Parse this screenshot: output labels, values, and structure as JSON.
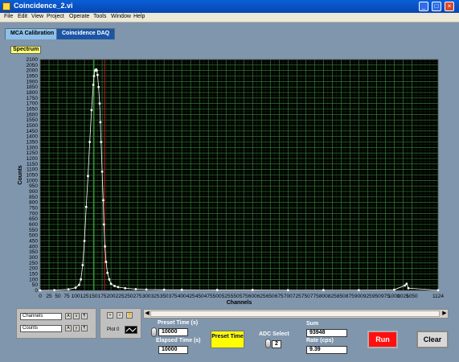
{
  "window": {
    "title": "Coincidence_2.vi"
  },
  "menu": [
    "File",
    "Edit",
    "View",
    "Project",
    "Operate",
    "Tools",
    "Window",
    "Help"
  ],
  "tabs": [
    {
      "label": "MCA Calibration",
      "active": true
    },
    {
      "label": "Coincidence DAQ",
      "active": false
    }
  ],
  "spectrum": {
    "label": "Spectrum"
  },
  "legend": {
    "x_axis_name": "Channels",
    "y_axis_name": "Counts",
    "plot_name": "Plot 0"
  },
  "controls": {
    "preset_time_label": "Preset Time (s)",
    "preset_time_value": "10000",
    "elapsed_time_label": "Elapsed Time (s)",
    "elapsed_time_value": "10000",
    "preset_button": "Preset Time",
    "adc_select_label": "ADC Select",
    "adc_select_value": "2",
    "sum_label": "Sum",
    "sum_value": "93948",
    "rate_label": "Rate (cps)",
    "rate_value": "9.39",
    "run_button": "Run",
    "clear_button": "Clear"
  },
  "chart_data": {
    "type": "scatter",
    "xlabel": "Channels",
    "ylabel": "Counts",
    "xlim": [
      0,
      1124
    ],
    "ylim": [
      0,
      2100
    ],
    "x_ticks": [
      0,
      25,
      50,
      75,
      100,
      125,
      150,
      175,
      200,
      225,
      250,
      275,
      300,
      325,
      350,
      375,
      400,
      425,
      450,
      475,
      500,
      525,
      550,
      575,
      600,
      625,
      650,
      675,
      700,
      725,
      750,
      775,
      800,
      825,
      850,
      875,
      900,
      925,
      950,
      975,
      1000,
      1025,
      1050,
      1124
    ],
    "x_tick_labels": [
      "0",
      "25",
      "50",
      "75",
      "100",
      "125",
      "150",
      "175",
      "200",
      "225",
      "250",
      "275",
      "300",
      "325",
      "350",
      "375",
      "400",
      "425",
      "450",
      "475",
      "500",
      "525",
      "550",
      "575",
      "600",
      "625",
      "650",
      "675",
      "700",
      "725",
      "750",
      "775",
      "800",
      "825",
      "850",
      "875",
      "900",
      "925",
      "950",
      "975",
      "1000",
      "1025",
      "1050",
      "1124"
    ],
    "y_ticks": [
      0,
      50,
      100,
      150,
      200,
      250,
      300,
      350,
      400,
      450,
      500,
      550,
      600,
      650,
      700,
      750,
      800,
      850,
      900,
      950,
      1000,
      1050,
      1100,
      1150,
      1200,
      1250,
      1300,
      1350,
      1400,
      1450,
      1500,
      1550,
      1600,
      1650,
      1700,
      1750,
      1800,
      1850,
      1900,
      1950,
      2000,
      2050,
      2100
    ],
    "grid": true,
    "background": "#000000",
    "grid_color": "#1f5a1f",
    "series": [
      {
        "color": "#ffffff",
        "x": [
          0,
          40,
          80,
          100,
          110,
          115,
          120,
          125,
          130,
          135,
          140,
          145,
          150,
          152,
          155,
          158,
          160,
          162,
          165,
          168,
          170,
          172,
          175,
          178,
          180,
          183,
          186,
          190,
          195,
          200,
          210,
          220,
          240,
          270,
          300,
          350,
          400,
          500,
          600,
          700,
          800,
          900,
          1000,
          1030,
          1035,
          1040,
          1124
        ],
        "y": [
          0,
          3,
          10,
          25,
          50,
          100,
          230,
          450,
          760,
          1040,
          1350,
          1640,
          1870,
          1950,
          2000,
          2010,
          2000,
          1960,
          1850,
          1700,
          1530,
          1350,
          1080,
          820,
          600,
          400,
          260,
          160,
          100,
          60,
          40,
          30,
          20,
          12,
          8,
          6,
          5,
          4,
          4,
          3,
          3,
          3,
          6,
          45,
          60,
          20,
          2
        ]
      }
    ],
    "cursors": [
      {
        "x": 152,
        "color": "#2fa82f"
      },
      {
        "x": 182,
        "color": "#c02020"
      }
    ]
  }
}
